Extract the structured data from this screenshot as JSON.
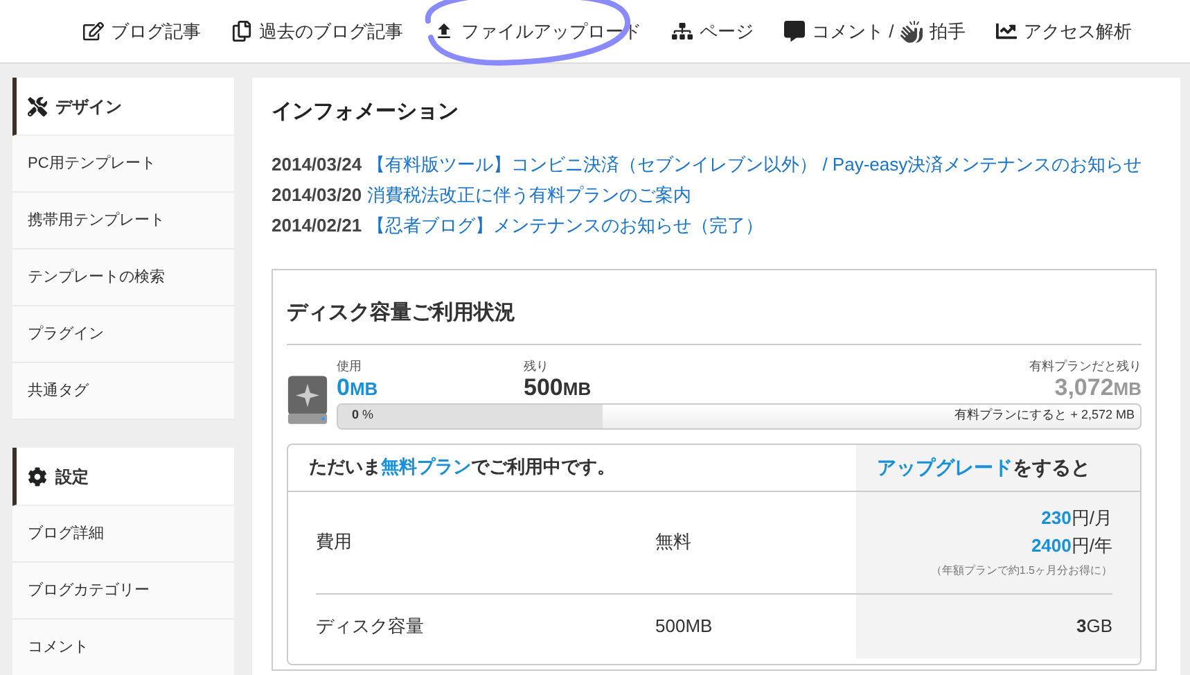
{
  "top_nav": [
    {
      "label": "ブログ記事",
      "selected": false
    },
    {
      "label": "過去のブログ記事",
      "selected": false
    },
    {
      "label": "ファイルアップロード",
      "selected": true
    },
    {
      "label": "ページ",
      "selected": false
    },
    {
      "label": "コメント /",
      "extra_label": "拍手",
      "selected": false
    },
    {
      "label": "アクセス解析",
      "selected": false
    }
  ],
  "sidebar": [
    {
      "title": "デザイン",
      "items": [
        "PC用テンプレート",
        "携帯用テンプレート",
        "テンプレートの検索",
        "プラグイン",
        "共通タグ"
      ]
    },
    {
      "title": "設定",
      "items": [
        "ブログ詳細",
        "ブログカテゴリー",
        "コメント"
      ]
    }
  ],
  "info": {
    "title": "インフォメーション",
    "news": [
      {
        "date": "2014/03/24",
        "text": "【有料版ツール】コンビニ決済（セブンイレブン以外） / Pay-easy決済メンテナンスのお知らせ"
      },
      {
        "date": "2014/03/20",
        "text": "消費税法改正に伴う有料プランのご案内"
      },
      {
        "date": "2014/02/21",
        "text": "【忍者ブログ】メンテナンスのお知らせ（完了）"
      }
    ]
  },
  "disk": {
    "title": "ディスク容量ご利用状況",
    "used_label": "使用",
    "used_value": "0",
    "used_unit": "MB",
    "remaining_label": "残り",
    "remaining_value": "500",
    "remaining_unit": "MB",
    "paid_label": "有料プランだと残り",
    "paid_value": "3,072",
    "paid_unit": "MB",
    "percent": "0",
    "percent_unit": "%",
    "level": 0,
    "bar_note": "有料プランにすると + 2,572",
    "bar_note_unit": "MB"
  },
  "plan": {
    "status_prefix": "ただいま",
    "status_plan": "無料プラン",
    "status_suffix": "でご利用中です。",
    "upgrade_link": "アップグレード",
    "upgrade_suffix": "をすると",
    "rows": [
      {
        "label": "費用",
        "free": "無料",
        "paid": [
          {
            "amount": "230",
            "unit": "円/月"
          },
          {
            "amount": "2400",
            "unit": "円/年"
          }
        ],
        "note": "（年額プランで約1.5ヶ月分お得に）"
      },
      {
        "label": "ディスク容量",
        "free": "500MB",
        "paid": [
          {
            "amount": "3",
            "unit": "GB"
          }
        ]
      }
    ]
  }
}
